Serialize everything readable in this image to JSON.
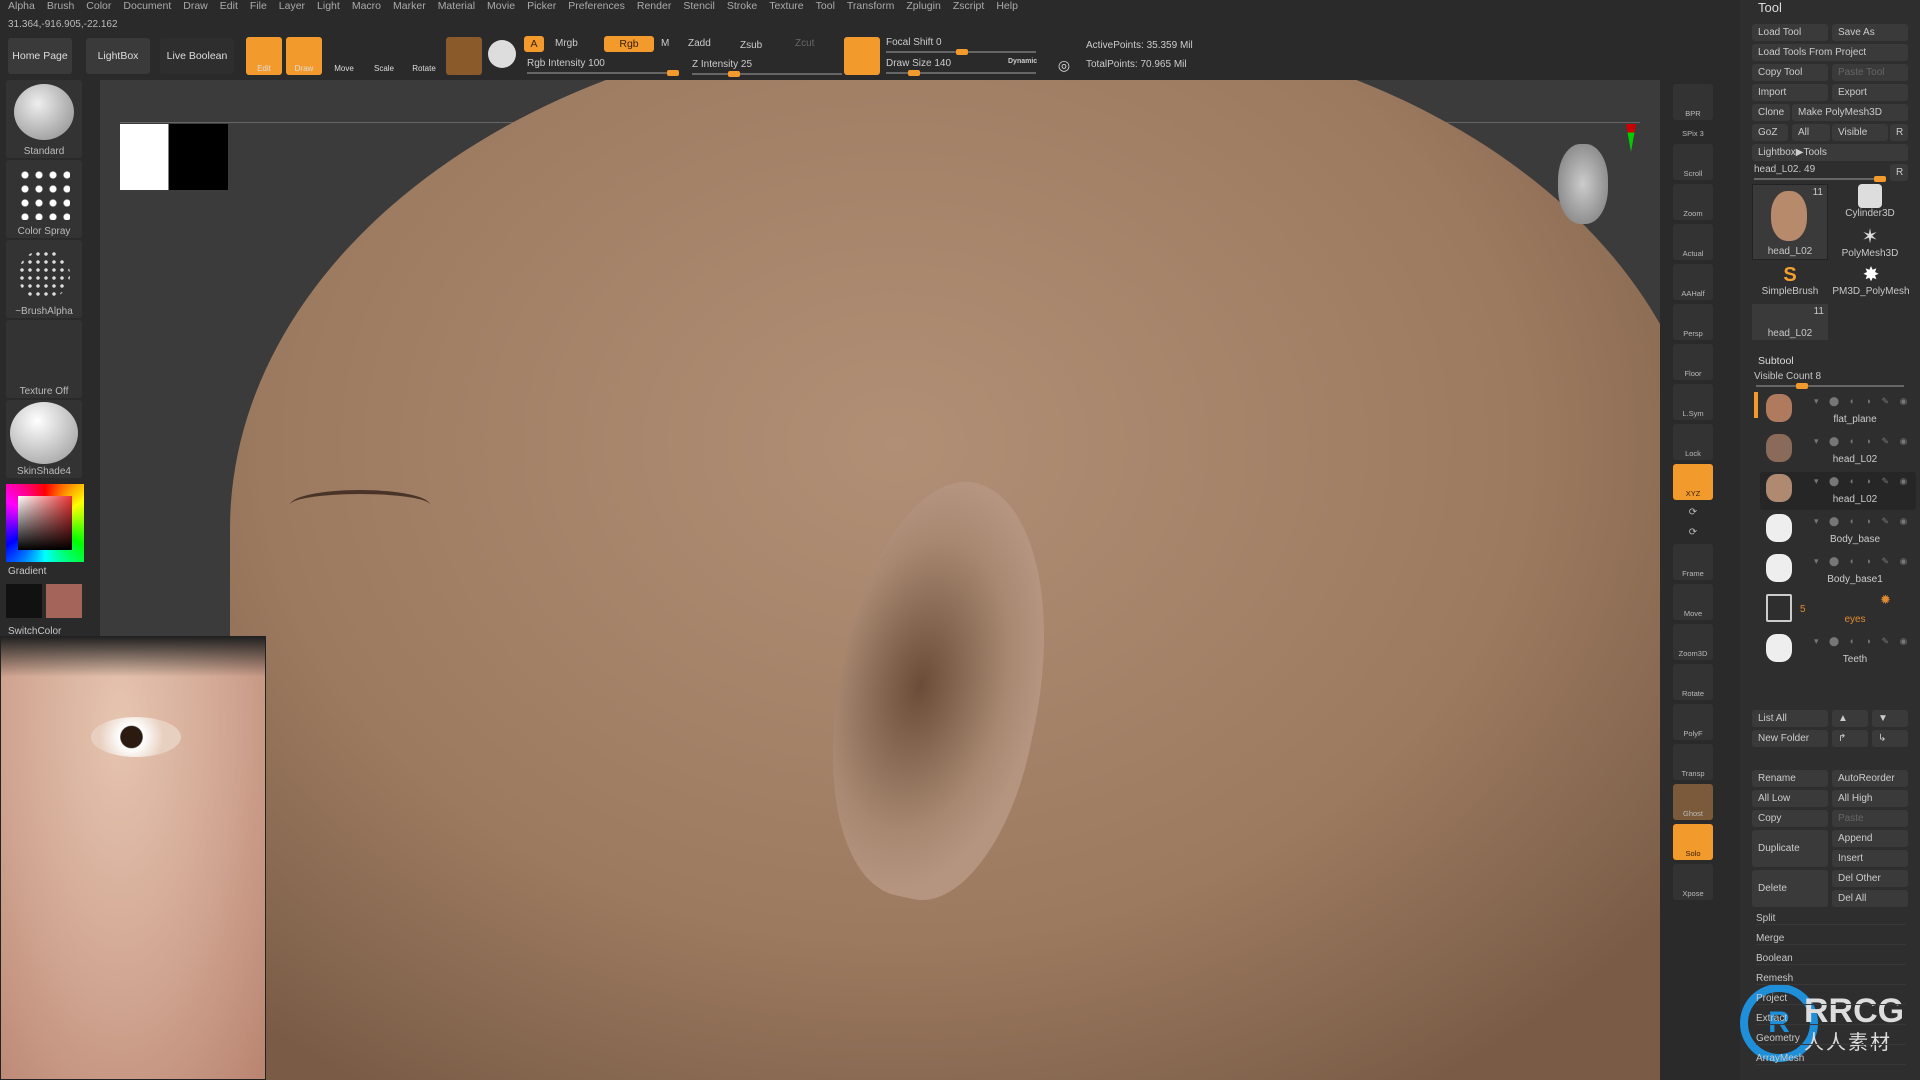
{
  "menu": [
    "Alpha",
    "Brush",
    "Color",
    "Document",
    "Draw",
    "Edit",
    "File",
    "Layer",
    "Light",
    "Macro",
    "Marker",
    "Material",
    "Movie",
    "Picker",
    "Preferences",
    "Render",
    "Stencil",
    "Stroke",
    "Texture",
    "Tool",
    "Transform",
    "Zplugin",
    "Zscript",
    "Help"
  ],
  "coords": "31.364,-916.905,-22.162",
  "toolbar": {
    "home": "Home Page",
    "lightbox": "LightBox",
    "live_boolean": "Live Boolean",
    "edit": "Edit",
    "draw": "Draw",
    "move": "Move",
    "scale": "Scale",
    "rotate": "Rotate",
    "a": "A",
    "mrgb": "Mrgb",
    "rgb": "Rgb",
    "m": "M",
    "zadd": "Zadd",
    "zsub": "Zsub",
    "zcut": "Zcut",
    "rgb_intensity": "Rgb Intensity 100",
    "z_intensity": "Z Intensity 25",
    "focal_shift": "Focal Shift 0",
    "draw_size": "Draw Size 140",
    "dynamic": "Dynamic",
    "active_points": "ActivePoints: 35.359 Mil",
    "total_points": "TotalPoints: 70.965 Mil",
    "rgb_intensity_value": 100,
    "z_intensity_value": 25,
    "focal_shift_value": 0,
    "draw_size_value": 140
  },
  "shelf": {
    "brush": "Standard",
    "stroke": "Color Spray",
    "alpha": "~BrushAlpha",
    "texture": "Texture Off",
    "material": "SkinShade4",
    "gradient": "Gradient",
    "switch": "SwitchColor",
    "main_color": "#a5645a",
    "secondary_color": "#111111"
  },
  "rightbar": [
    "BPR",
    "SPix 3",
    "Scroll",
    "Zoom",
    "Actual",
    "AAHalf",
    "Persp",
    "Floor",
    "L.Sym",
    "Lock",
    "XYZ",
    "",
    "",
    "Frame",
    "Move",
    "Zoom3D",
    "Rotate",
    "PolyF",
    "Transp",
    "Ghost",
    "Solo",
    "Xpose"
  ],
  "tool": {
    "title": "Tool",
    "load": "Load Tool",
    "save_as": "Save As",
    "load_project": "Load Tools From Project",
    "copy": "Copy Tool",
    "paste": "Paste Tool",
    "import": "Import",
    "export": "Export",
    "clone": "Clone",
    "make_polymesh": "Make PolyMesh3D",
    "goz": "GoZ",
    "all": "All",
    "visible": "Visible",
    "r": "R",
    "lightbox_tools": "Lightbox▶Tools",
    "current": "head_L02. 49",
    "thumbs": [
      {
        "name": "head_L02",
        "count": "11"
      },
      {
        "name": "Cylinder3D"
      },
      {
        "name": "PolyMesh3D"
      },
      {
        "name": "SimpleBrush"
      },
      {
        "name": "PM3D_PolyMesh"
      },
      {
        "name": "head_L02",
        "count": "11"
      }
    ]
  },
  "subtool": {
    "title": "Subtool",
    "visible_count": "Visible Count 8",
    "items": [
      "flat_plane",
      "head_L02",
      "head_L02",
      "Body_base",
      "Body_base1",
      "eyes",
      "Teeth"
    ],
    "folder_count": "5",
    "list_all": "List All",
    "new_folder": "New Folder",
    "rename": "Rename",
    "autoreorder": "AutoReorder",
    "all_low": "All Low",
    "all_high": "All High",
    "copy": "Copy",
    "paste": "Paste",
    "duplicate": "Duplicate",
    "append": "Append",
    "insert": "Insert",
    "delete": "Delete",
    "del_other": "Del Other",
    "del_all": "Del All"
  },
  "sections": [
    "Split",
    "Merge",
    "Boolean",
    "Remesh",
    "Project",
    "Extract",
    "Geometry",
    "ArrayMesh"
  ],
  "watermark": {
    "brand": "RRCG",
    "cn": "人人素材"
  }
}
